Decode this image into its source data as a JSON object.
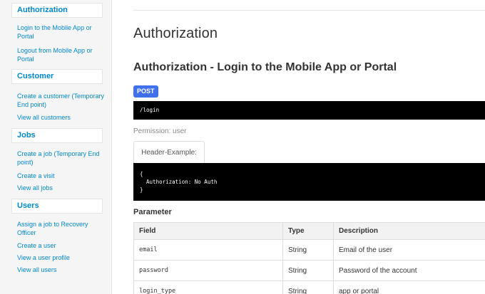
{
  "sidebar": {
    "sections": [
      {
        "title": "Authorization",
        "links": [
          "Login to the Mobile App or Portal",
          "Logout from Mobile App or Portal"
        ]
      },
      {
        "title": "Customer",
        "links": [
          "Create a customer (Temporary End point)",
          "View all customers"
        ]
      },
      {
        "title": "Jobs",
        "links": [
          "Create a job (Temporary End point)",
          "Create a visit",
          "View all jobs"
        ]
      },
      {
        "title": "Users",
        "links": [
          "Assign a job to Recovery Officer",
          "Create a user",
          "View a user profile",
          "View all users"
        ]
      }
    ]
  },
  "main": {
    "page_title": "Authorization",
    "endpoint_title": "Authorization - Login to the Mobile App or Portal",
    "method": "POST",
    "path": "/login",
    "permission": "Permission: user",
    "tab_label": "Header-Example:",
    "header_example": "{\n  Authorization: No Auth\n}",
    "parameter_title": "Parameter",
    "table": {
      "headers": [
        "Field",
        "Type",
        "Description"
      ],
      "rows": [
        [
          "email",
          "String",
          "Email of the user"
        ],
        [
          "password",
          "String",
          "Password of the account"
        ],
        [
          "login_type",
          "String",
          "app or portal"
        ]
      ]
    }
  }
}
